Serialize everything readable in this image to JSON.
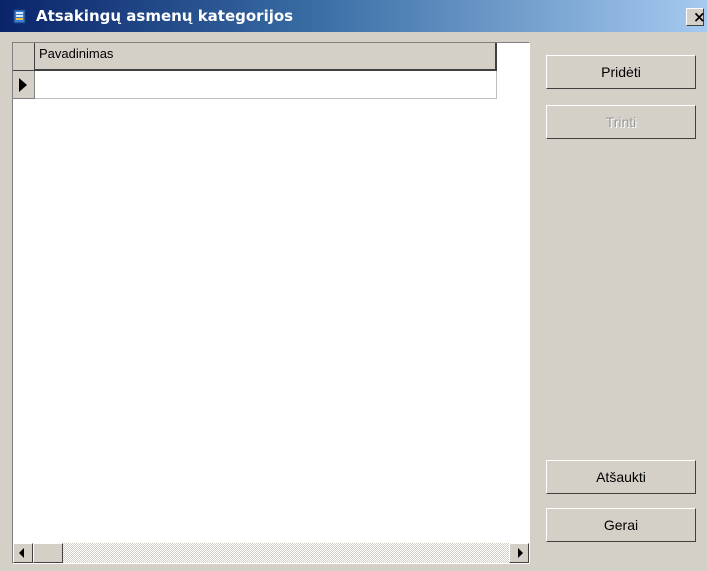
{
  "window": {
    "title": "Atsakingų asmenų kategorijos",
    "close_label": "×"
  },
  "grid": {
    "columns": [
      "Pavadinimas"
    ],
    "rows": [
      {
        "current": true,
        "cells": [
          ""
        ]
      }
    ]
  },
  "buttons": {
    "add_label": "Pridėti",
    "delete_label": "Trinti",
    "delete_enabled": false,
    "cancel_label": "Atšaukti",
    "ok_label": "Gerai"
  },
  "colors": {
    "titlebar_start": "#0a246a",
    "titlebar_end": "#a6caf0",
    "face": "#d4d0c8"
  }
}
